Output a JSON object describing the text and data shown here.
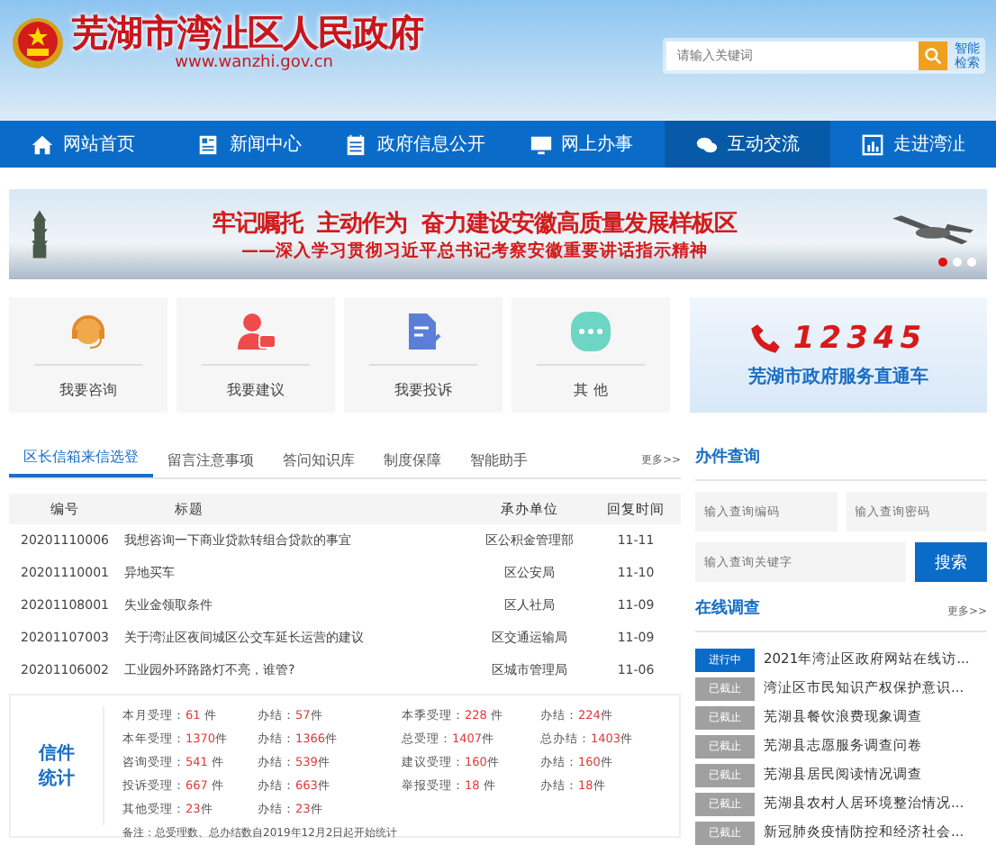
{
  "header": {
    "title": "芜湖市湾沚区人民政府",
    "url": "www.wanzhi.gov.cn",
    "search": {
      "placeholder": "请输入关键词"
    },
    "smart_search": "智能检索"
  },
  "nav": [
    {
      "label": "网站首页",
      "selected": false
    },
    {
      "label": "新闻中心",
      "selected": false
    },
    {
      "label": "政府信息公开",
      "selected": false
    },
    {
      "label": "网上办事",
      "selected": false
    },
    {
      "label": "互动交流",
      "selected": true
    },
    {
      "label": "走进湾沚",
      "selected": false
    }
  ],
  "banner": {
    "headline": "牢记嘱托  主动作为  奋力建设安徽高质量发展样板区",
    "subline": "——深入学习贯彻习近平总书记考察安徽重要讲话指示精神",
    "dots": [
      {
        "selected": true
      },
      {
        "selected": false
      },
      {
        "selected": false
      }
    ]
  },
  "services": [
    {
      "label": "我要咨询"
    },
    {
      "label": "我要建议"
    },
    {
      "label": "我要投诉"
    },
    {
      "label": "其 他"
    }
  ],
  "hotline": {
    "number": "12345",
    "caption": "芜湖市政府服务直通车"
  },
  "mail_tabs": [
    {
      "label": "区长信箱来信选登",
      "selected": true
    },
    {
      "label": "留言注意事项",
      "selected": false
    },
    {
      "label": "答问知识库",
      "selected": false
    },
    {
      "label": "制度保障",
      "selected": false
    },
    {
      "label": "智能助手",
      "selected": false
    }
  ],
  "mail_more": "更多>>",
  "table": {
    "columns": [
      "编号",
      "标题",
      "承办单位",
      "回复时间"
    ],
    "rows": [
      [
        "20201110006",
        "我想咨询一下商业贷款转组合贷款的事宜",
        "区公积金管理部",
        "11-11"
      ],
      [
        "20201110001",
        "异地买车",
        "区公安局",
        "11-10"
      ],
      [
        "20201108001",
        "失业金领取条件",
        "区人社局",
        "11-09"
      ],
      [
        "20201107003",
        "关于湾沚区夜间城区公交车延长运营的建议",
        "区交通运输局",
        "11-09"
      ],
      [
        "20201106002",
        "工业园外环路路灯不亮，谁管?",
        "区城市管理局",
        "11-06"
      ]
    ]
  },
  "stats": {
    "title": "信件统计",
    "rows": [
      [
        {
          "label": "本月受理：",
          "value": "61",
          "unit": " 件"
        },
        {
          "label": "办结：",
          "value": "57",
          "unit": "件"
        },
        {
          "label": "本季受理：",
          "value": "228",
          "unit": " 件"
        },
        {
          "label": "办结：",
          "value": "224",
          "unit": "件"
        }
      ],
      [
        {
          "label": "本年受理：",
          "value": "1370",
          "unit": "件"
        },
        {
          "label": "办结：",
          "value": "1366",
          "unit": "件"
        },
        {
          "label": "总受理：",
          "value": "1407",
          "unit": "件"
        },
        {
          "label": "总办结：",
          "value": "1403",
          "unit": "件"
        }
      ],
      [
        {
          "label": "咨询受理：",
          "value": "541",
          "unit": " 件"
        },
        {
          "label": "办结：",
          "value": "539",
          "unit": "件"
        },
        {
          "label": "建议受理：",
          "value": "160",
          "unit": "件"
        },
        {
          "label": "办结：",
          "value": "160",
          "unit": "件"
        }
      ],
      [
        {
          "label": "投诉受理：",
          "value": "667",
          "unit": " 件"
        },
        {
          "label": "办结：",
          "value": "663",
          "unit": "件"
        },
        {
          "label": "举报受理：",
          "value": "18",
          "unit": " 件"
        },
        {
          "label": "办结：",
          "value": "18",
          "unit": "件"
        }
      ],
      [
        {
          "label": "其他受理：",
          "value": "23",
          "unit": "件"
        },
        {
          "label": "办结：",
          "value": "23",
          "unit": "件"
        }
      ]
    ],
    "note": "备注：总受理数、总办结数自2019年12月2日起开始统计"
  },
  "query": {
    "title": "办件查询",
    "code_placeholder": "输入查询编码",
    "password_placeholder": "输入查询密码",
    "keyword_placeholder": "输入查询关键字",
    "button": "搜索"
  },
  "survey": {
    "title": "在线调查",
    "more": "更多>>",
    "items": [
      {
        "status": "进行中",
        "active": true,
        "title": "2021年湾沚区政府网站在线访..."
      },
      {
        "status": "已截止",
        "active": false,
        "title": "湾沚区市民知识产权保护意识..."
      },
      {
        "status": "已截止",
        "active": false,
        "title": "芜湖县餐饮浪费现象调查"
      },
      {
        "status": "已截止",
        "active": false,
        "title": "芜湖县志愿服务调查问卷"
      },
      {
        "status": "已截止",
        "active": false,
        "title": "芜湖县居民阅读情况调查"
      },
      {
        "status": "已截止",
        "active": false,
        "title": "芜湖县农村人居环境整治情况..."
      },
      {
        "status": "已截止",
        "active": false,
        "title": "新冠肺炎疫情防控和经济社会..."
      }
    ]
  }
}
